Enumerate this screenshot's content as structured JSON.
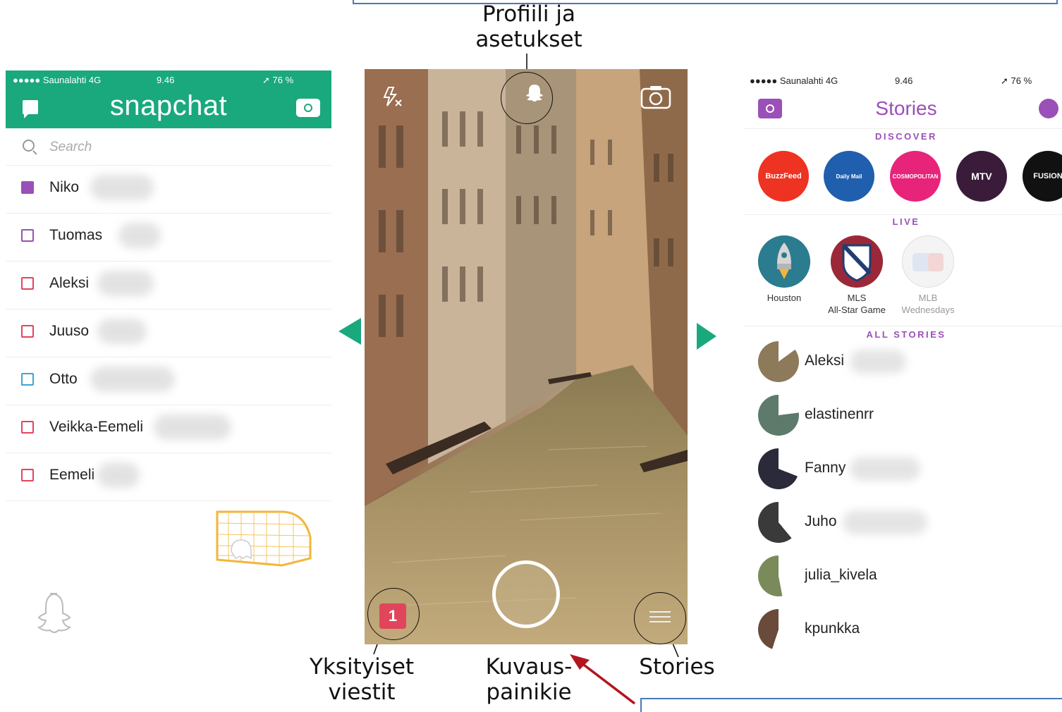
{
  "annotations": {
    "profile": "Profiili ja\nasetukset",
    "private_messages": "Yksityiset\nviestit",
    "capture": "Kuvaus-\npainikie",
    "stories": "Stories"
  },
  "left_screen": {
    "status": {
      "carrier": "●●●●● Saunalahti  4G",
      "time": "9.46",
      "battery": "➚ 76 %"
    },
    "title": "snapchat",
    "search_placeholder": "Search",
    "friends": [
      {
        "name": "Niko",
        "marker": "#9b4fb8",
        "filled": true
      },
      {
        "name": "Tuomas",
        "marker": "#9b4fb8",
        "filled": false
      },
      {
        "name": "Aleksi",
        "marker": "#e0455c",
        "filled": false
      },
      {
        "name": "Juuso",
        "marker": "#e0455c",
        "filled": false
      },
      {
        "name": "Otto",
        "marker": "#3aa5d8",
        "filled": false,
        "chat": true
      },
      {
        "name": "Veikka-Eemeli",
        "marker": "#e0455c",
        "filled": false
      },
      {
        "name": "Eemeli",
        "marker": "#e0455c",
        "filled": false
      }
    ],
    "accent": "#1aa87d"
  },
  "camera": {
    "unread_count": "1",
    "icons": [
      "flash-off-icon",
      "ghost-icon",
      "flip-camera-icon",
      "menu-icon"
    ]
  },
  "right_screen": {
    "status": {
      "carrier": "●●●●● Saunalahti  4G",
      "time": "9.46",
      "battery": "➚ 76 %"
    },
    "title": "Stories",
    "sections": {
      "discover": "DISCOVER",
      "live": "LIVE",
      "all": "ALL STORIES"
    },
    "discover": [
      {
        "label": "BuzzFeed",
        "bg": "#ee3322"
      },
      {
        "label": "Daily Mail",
        "bg": "#1f5fad"
      },
      {
        "label": "COSMOPOLITAN",
        "bg": "#e8237a"
      },
      {
        "label": "MTV",
        "bg": "#3a1c3a"
      },
      {
        "label": "FUSION",
        "bg": "#111111"
      }
    ],
    "live": [
      {
        "label": "Houston"
      },
      {
        "label": "MLS\nAll-Star Game"
      },
      {
        "label": "MLB\nWednesdays"
      }
    ],
    "stories": [
      {
        "name": "Aleksi"
      },
      {
        "name": "elastinenrr"
      },
      {
        "name": "Fanny"
      },
      {
        "name": "Juho"
      },
      {
        "name": "julia_kivela"
      },
      {
        "name": "kpunkka"
      }
    ],
    "accent": "#9b4fb8"
  }
}
